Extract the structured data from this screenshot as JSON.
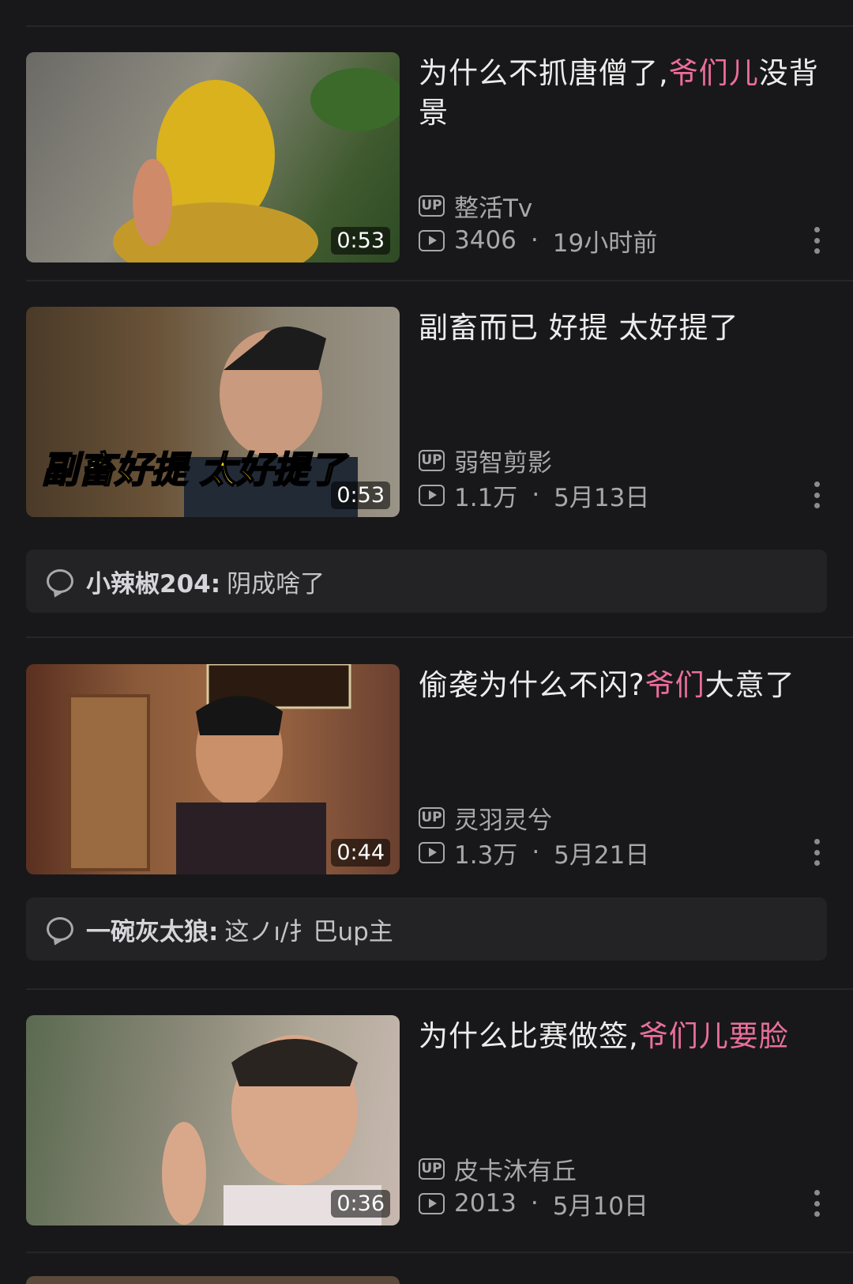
{
  "colors": {
    "background": "#18181a",
    "highlight": "#ea6e9a",
    "meta": "#a8a8ac"
  },
  "videos": [
    {
      "title_parts": [
        "为什么不抓唐僧了,",
        "爷们儿",
        "没背景"
      ],
      "duration": "0:53",
      "uploader": "整活Tv",
      "views": "3406",
      "date": "19小时前"
    },
    {
      "title_parts": [
        "副畜而已 好提 太好提了",
        "",
        ""
      ],
      "duration": "0:53",
      "thumb_caption": "副畜好提 太好提了",
      "uploader": "弱智剪影",
      "views": "1.1万",
      "date": "5月13日",
      "comment": {
        "user": "小辣椒204:",
        "text": "阴成啥了"
      }
    },
    {
      "title_parts": [
        "偷袭为什么不闪?",
        "爷们",
        "大意了"
      ],
      "duration": "0:44",
      "uploader": "灵羽灵兮",
      "views": "1.3万",
      "date": "5月21日",
      "comment": {
        "user": "一碗灰太狼:",
        "text": "这ノı/扌巴up主"
      }
    },
    {
      "title_parts": [
        "为什么比赛做签,",
        "爷们儿要脸",
        ""
      ],
      "duration": "0:36",
      "uploader": "皮卡沐有丘",
      "views": "2013",
      "date": "5月10日"
    }
  ],
  "labels": {
    "up_badge": "UP",
    "separator": "·"
  },
  "icons": [
    "up-badge-icon",
    "play-count-icon",
    "more-vertical-icon",
    "comment-bubble-icon"
  ]
}
